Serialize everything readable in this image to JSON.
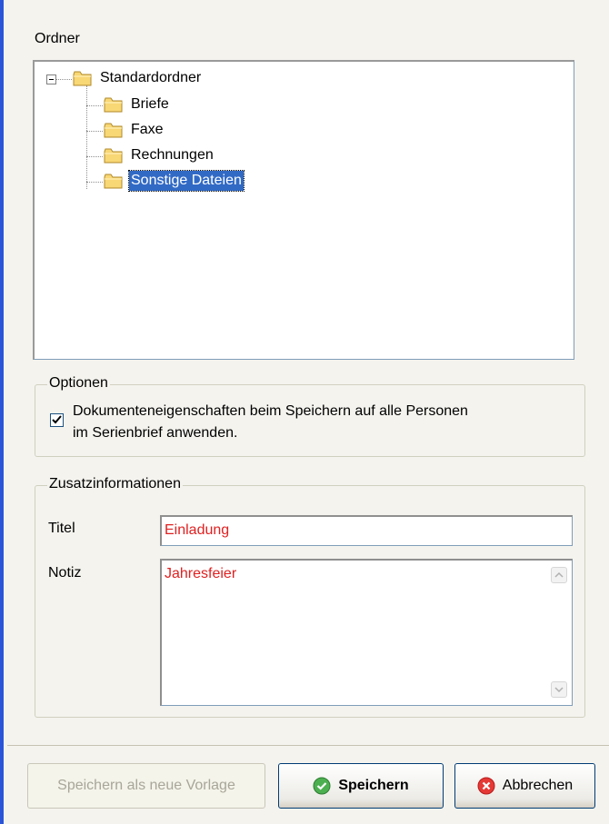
{
  "folder_section": {
    "label": "Ordner",
    "tree": {
      "root": "Standardordner",
      "children": [
        "Briefe",
        "Faxe",
        "Rechnungen",
        "Sonstige Dateien"
      ],
      "selected": "Sonstige Dateien"
    }
  },
  "options": {
    "legend": "Optionen",
    "checkbox_label_line1": "Dokumenteneigenschaften beim Speichern auf alle Personen",
    "checkbox_label_line2": "im Serienbrief anwenden.",
    "checked": true
  },
  "extra_info": {
    "legend": "Zusatzinformationen",
    "title_label": "Titel",
    "title_value": "Einladung",
    "note_label": "Notiz",
    "note_value": "Jahresfeier"
  },
  "buttons": {
    "save_as_template": "Speichern als neue Vorlage",
    "save": "Speichern",
    "cancel": "Abbrechen"
  },
  "icons": {
    "folder": "folder-icon",
    "save": "green-check-circle-icon",
    "cancel": "red-x-circle-icon"
  },
  "colors": {
    "selection": "#316ac5",
    "field_text": "#e02020",
    "accent_edge": "#2a55d8"
  }
}
